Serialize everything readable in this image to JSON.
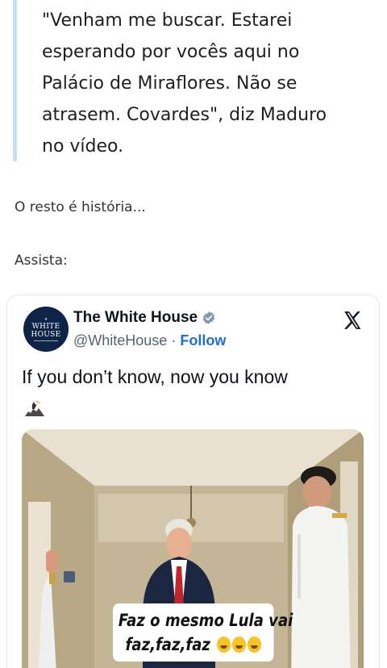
{
  "article": {
    "quote_lines": [
      "\"Venham me buscar. Estarei",
      "esperando por vocês aqui no",
      "Palácio de Miraflores. Não se",
      "atrasem. Covardes\", diz Maduro",
      "no vídeo."
    ],
    "para1": "O resto é história...",
    "para2": "Assista:"
  },
  "tweet": {
    "account_name": "The White House",
    "handle": "@WhiteHouse",
    "separator": " · ",
    "follow_label": "Follow",
    "avatar_line1": "WHITE",
    "avatar_line2": "HOUSE",
    "text": "If you don’t know, now you know",
    "emoji_icon": "eagle-icon"
  },
  "video": {
    "caption_line1": "Faz o mesmo Lula vai",
    "caption_line2": "faz,faz,faz"
  },
  "colors": {
    "quote_bar": "#c7dff2",
    "follow": "#1d6fd1",
    "verified": "#829aab",
    "avatar_bg": "#0d2447"
  }
}
